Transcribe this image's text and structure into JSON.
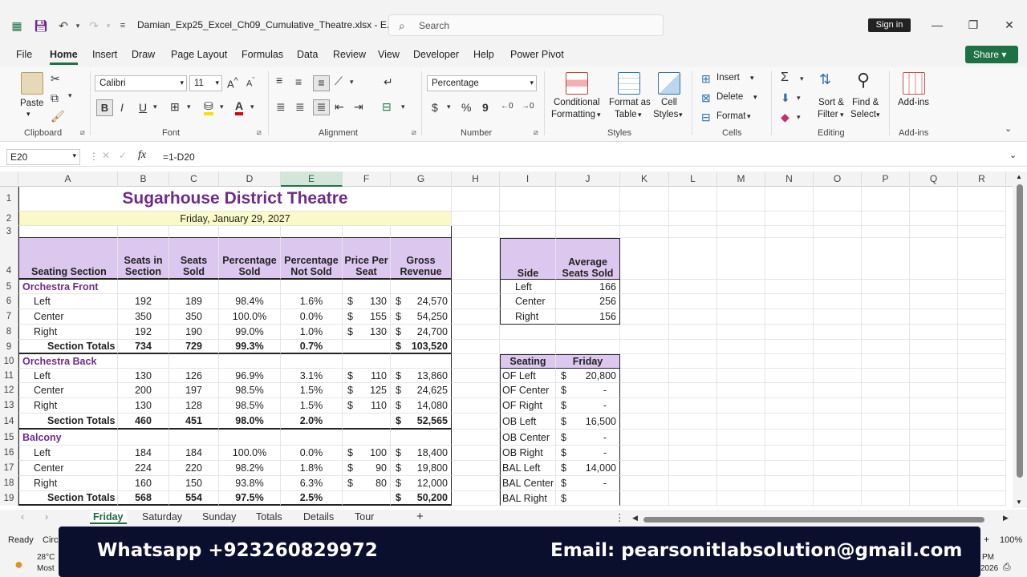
{
  "window": {
    "title": "Damian_Exp25_Excel_Ch09_Cumulative_Theatre.xlsx  -  E...",
    "search_placeholder": "Search",
    "signin": "Sign in"
  },
  "menu": [
    "File",
    "Home",
    "Insert",
    "Draw",
    "Page Layout",
    "Formulas",
    "Data",
    "Review",
    "View",
    "Developer",
    "Help",
    "Power Pivot"
  ],
  "share": "Share",
  "ribbon": {
    "clipboard": {
      "paste": "Paste",
      "label": "Clipboard"
    },
    "font": {
      "name": "Calibri",
      "size": "11",
      "label": "Font"
    },
    "alignment": {
      "label": "Alignment"
    },
    "number": {
      "format": "Percentage",
      "currency": "$",
      "percent": "%",
      "comma": "9",
      "label": "Number"
    },
    "styles": {
      "cond1": "Conditional",
      "cond2": "Formatting",
      "fmt1": "Format as",
      "fmt2": "Table",
      "cell1": "Cell",
      "cell2": "Styles",
      "label": "Styles"
    },
    "cells": {
      "insert": "Insert",
      "delete": "Delete",
      "format": "Format",
      "label": "Cells"
    },
    "editing": {
      "sort1": "Sort &",
      "sort2": "Filter",
      "find1": "Find &",
      "find2": "Select",
      "label": "Editing"
    },
    "addins": {
      "btn": "Add-ins",
      "label": "Add-ins"
    }
  },
  "formula_bar": {
    "cell": "E20",
    "formula": "=1-D20",
    "fx": "fx"
  },
  "columns": [
    "A",
    "B",
    "C",
    "D",
    "E",
    "F",
    "G",
    "H",
    "I",
    "J",
    "K",
    "L",
    "M",
    "N",
    "O",
    "P",
    "Q",
    "R"
  ],
  "rows": [
    "1",
    "2",
    "3",
    "4",
    "5",
    "6",
    "7",
    "8",
    "9",
    "10",
    "11",
    "12",
    "13",
    "14",
    "15",
    "16",
    "17",
    "18",
    "19"
  ],
  "sheet": {
    "title": "Sugarhouse District Theatre",
    "date": "Friday, January 29, 2027",
    "headers": {
      "a": "Seating Section",
      "b1": "Seats in",
      "b2": "Section",
      "c1": "Seats",
      "c2": "Sold",
      "d1": "Percentage",
      "d2": "Sold",
      "e1": "Percentage",
      "e2": "Not Sold",
      "f1": "Price Per",
      "f2": "Seat",
      "g1": "Gross",
      "g2": "Revenue"
    },
    "sections": {
      "of": "Orchestra Front",
      "ob": "Orchestra Back",
      "bal": "Balcony"
    },
    "data_rows": [
      {
        "label": "Left",
        "seats": "192",
        "sold": "189",
        "pct": "98.4%",
        "notsold": "1.6%",
        "price": "130",
        "rev": "24,570"
      },
      {
        "label": "Center",
        "seats": "350",
        "sold": "350",
        "pct": "100.0%",
        "notsold": "0.0%",
        "price": "155",
        "rev": "54,250"
      },
      {
        "label": "Right",
        "seats": "192",
        "sold": "190",
        "pct": "99.0%",
        "notsold": "1.0%",
        "price": "130",
        "rev": "24,700"
      },
      {
        "label": "Section Totals",
        "seats": "734",
        "sold": "729",
        "pct": "99.3%",
        "notsold": "0.7%",
        "price": "",
        "rev": "103,520"
      },
      {
        "label": "Left",
        "seats": "130",
        "sold": "126",
        "pct": "96.9%",
        "notsold": "3.1%",
        "price": "110",
        "rev": "13,860"
      },
      {
        "label": "Center",
        "seats": "200",
        "sold": "197",
        "pct": "98.5%",
        "notsold": "1.5%",
        "price": "125",
        "rev": "24,625"
      },
      {
        "label": "Right",
        "seats": "130",
        "sold": "128",
        "pct": "98.5%",
        "notsold": "1.5%",
        "price": "110",
        "rev": "14,080"
      },
      {
        "label": "Section Totals",
        "seats": "460",
        "sold": "451",
        "pct": "98.0%",
        "notsold": "2.0%",
        "price": "",
        "rev": "52,565"
      },
      {
        "label": "Left",
        "seats": "184",
        "sold": "184",
        "pct": "100.0%",
        "notsold": "0.0%",
        "price": "100",
        "rev": "18,400"
      },
      {
        "label": "Center",
        "seats": "224",
        "sold": "220",
        "pct": "98.2%",
        "notsold": "1.8%",
        "price": "90",
        "rev": "19,800"
      },
      {
        "label": "Right",
        "seats": "160",
        "sold": "150",
        "pct": "93.8%",
        "notsold": "6.3%",
        "price": "80",
        "rev": "12,000"
      },
      {
        "label": "Section Totals",
        "seats": "568",
        "sold": "554",
        "pct": "97.5%",
        "notsold": "2.5%",
        "price": "",
        "rev": "50,200"
      }
    ],
    "dollar": "$",
    "side_table": {
      "h1": "Average",
      "h2": "Seats Sold",
      "side": "Side",
      "rows": [
        {
          "side": "Left",
          "avg": "166"
        },
        {
          "side": "Center",
          "avg": "256"
        },
        {
          "side": "Right",
          "avg": "156"
        }
      ]
    },
    "rev_table": {
      "h_seating": "Seating",
      "h_friday": "Friday",
      "rows": [
        {
          "name": "OF Left",
          "val": "20,800"
        },
        {
          "name": "OF Center",
          "val": "-"
        },
        {
          "name": "OF Right",
          "val": "-"
        },
        {
          "name": "OB Left",
          "val": "16,500"
        },
        {
          "name": "OB Center",
          "val": "-"
        },
        {
          "name": "OB Right",
          "val": "-"
        },
        {
          "name": "BAL Left",
          "val": "14,000"
        },
        {
          "name": "BAL Center",
          "val": "-"
        },
        {
          "name": "BAL Right",
          "val": ""
        }
      ]
    }
  },
  "tabs": [
    "Friday",
    "Saturday",
    "Sunday",
    "Totals",
    "Details",
    "Tour"
  ],
  "status": {
    "ready": "Ready",
    "circ": "Circ",
    "zoom": "100%",
    "temp": "28°C",
    "weather": "Most",
    "time": "PM",
    "year": "2026"
  },
  "banner": {
    "left": "Whatsapp +923260829972",
    "right": "Email: pearsonitlabsolution@gmail.com"
  }
}
